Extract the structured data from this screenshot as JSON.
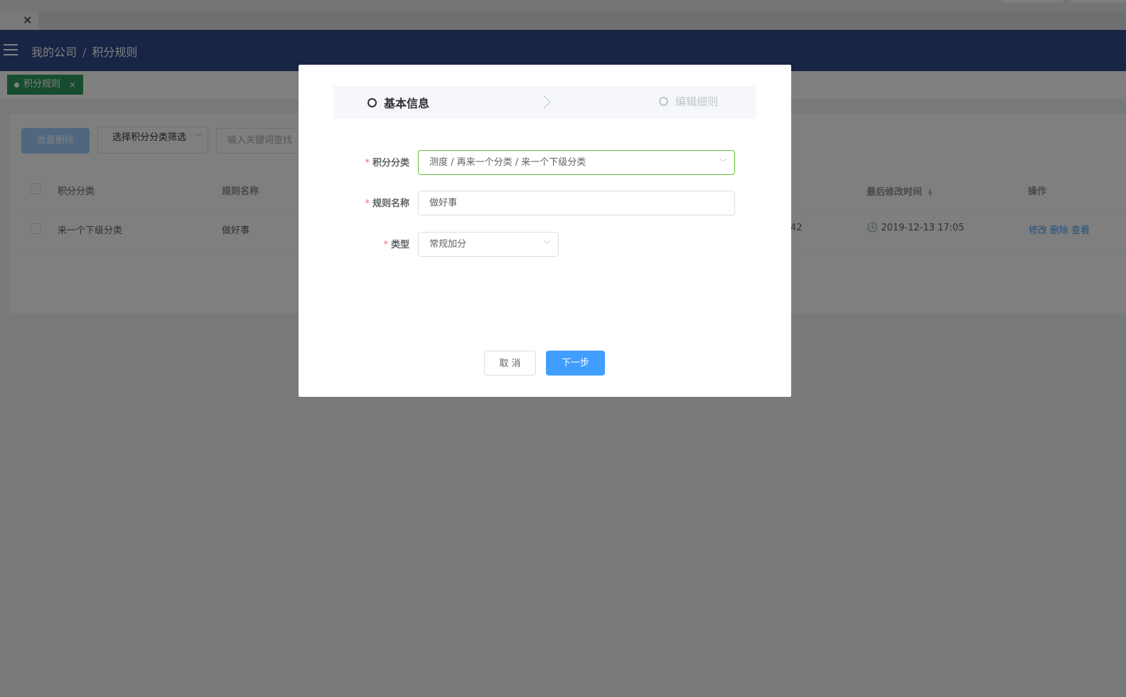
{
  "browser": {
    "title": "",
    "tab_close": "✕"
  },
  "header": {
    "breadcrumb": [
      "我的公司",
      "积分规则"
    ],
    "breadcrumb_sep": "/"
  },
  "tags": {
    "active_label": "积分规则",
    "close": "×"
  },
  "toolbar": {
    "batch_delete": "批量删除",
    "filter_select": "选择积分分类筛选",
    "search_placeholder": "输入关键词查找"
  },
  "table": {
    "columns": [
      "积分分类",
      "规则名称",
      "最后修改时间",
      "操作"
    ],
    "rows": [
      {
        "category": "来一个下级分类",
        "rule_name": "做好事",
        "partial": "42",
        "modified": "2019-12-13 17:05",
        "actions": [
          "修改",
          "删除",
          "查看"
        ]
      }
    ]
  },
  "dialog": {
    "steps": [
      "基本信息",
      "编辑细则"
    ],
    "form": {
      "category_label": "积分分类",
      "category_value": "测度 / 再来一个分类 / 来一个下级分类",
      "rule_name_label": "规则名称",
      "rule_name_value": "做好事",
      "type_label": "类型",
      "type_value": "常规加分",
      "required_mark": "*"
    },
    "cancel": "取 消",
    "next": "下一步"
  },
  "colors": {
    "appbar": "#304a8b",
    "tag_active": "#2f9a5e",
    "primary": "#409eff",
    "active_border": "#67c23a"
  }
}
